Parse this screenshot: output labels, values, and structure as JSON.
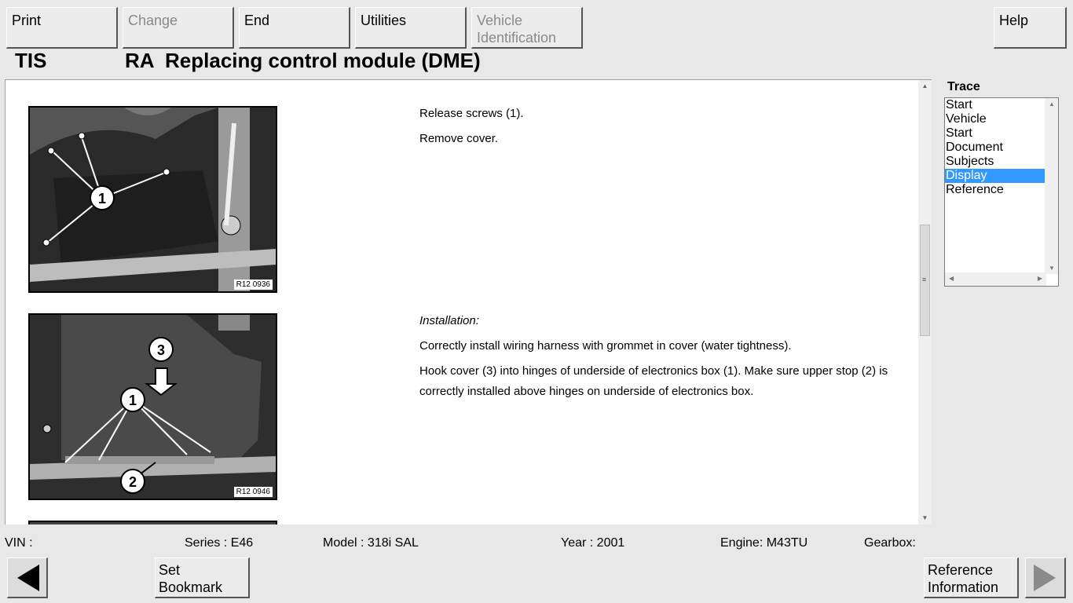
{
  "toolbar": {
    "print": "Print",
    "change": "Change",
    "end": "End",
    "utilities": "Utilities",
    "vehicle_identification": "Vehicle Identification",
    "help": "Help"
  },
  "header": {
    "app": "TIS",
    "title": "RA  Replacing control module (DME)"
  },
  "steps": [
    {
      "image_label": "R12 0936",
      "lines": [
        "Release screws (1).",
        "Remove cover."
      ]
    },
    {
      "image_label": "R12 0946",
      "heading": "Installation:",
      "lines": [
        "Correctly install wiring harness with grommet in cover (water tightness).",
        "Hook cover (3) into hinges of underside of electronics box (1). Make sure upper stop (2) is correctly installed above hinges on underside of electronics box."
      ]
    }
  ],
  "trace": {
    "label": "Trace",
    "items": [
      "Start",
      "Vehicle",
      "Start",
      "Document",
      "Subjects",
      "Display",
      "Reference"
    ],
    "selected_index": 5
  },
  "status": {
    "vin": "VIN :",
    "series": "Series : E46",
    "model": "Model : 318i SAL",
    "year": "Year : 2001",
    "engine": "Engine: M43TU",
    "gearbox": "Gearbox:"
  },
  "bottom": {
    "set_bookmark": "Set Bookmark",
    "reference_information": "Reference Information"
  },
  "icons": {
    "back": "triangle-left-icon",
    "forward": "triangle-right-icon"
  },
  "colors": {
    "selection": "#3399ff",
    "background": "#e8e8e8"
  }
}
